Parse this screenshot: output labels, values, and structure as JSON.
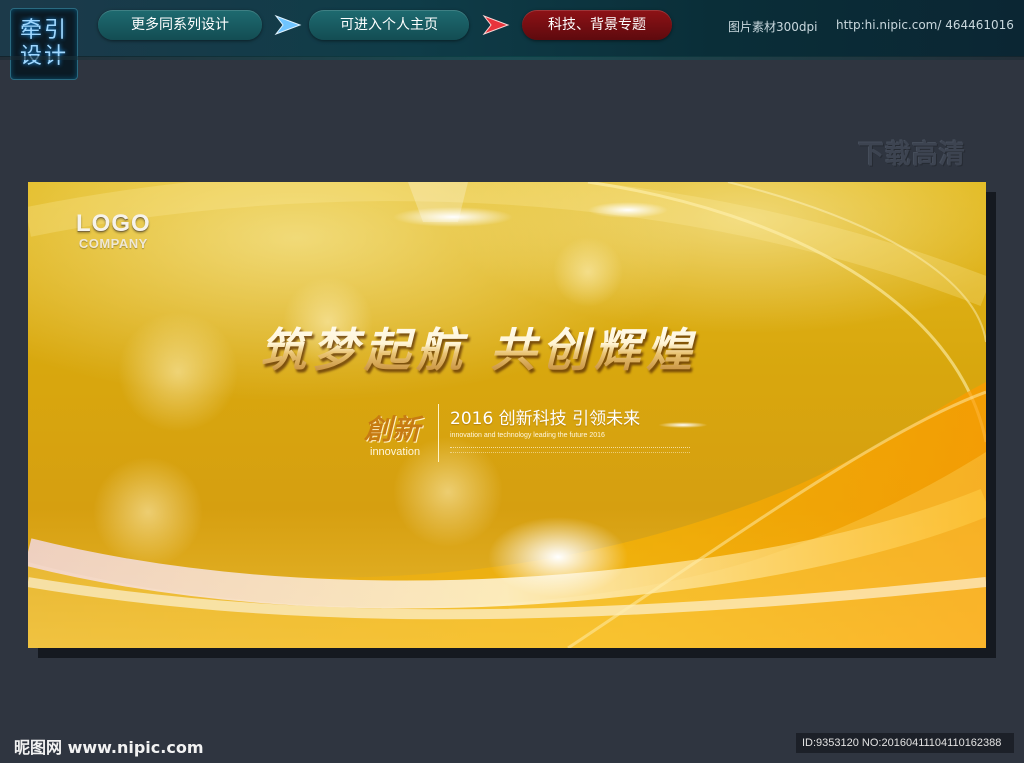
{
  "topbar": {
    "brand_line1": "牵引",
    "brand_line2": "设计",
    "nav": [
      {
        "label": "更多同系列设计"
      },
      {
        "label": "可进入个人主页"
      },
      {
        "label": "科技、背景专题"
      }
    ],
    "resolution_text": "图片素材300dpi",
    "url_text": "http:hi.nipic.com/ 464461016"
  },
  "watermark": "下载高清",
  "banner": {
    "logo_text": "LOGO",
    "company_text": "COMPANY",
    "headline": "筑梦起航 共创辉煌",
    "chuangxin": "創新",
    "innovation": "innovation",
    "subtitle": "2016 创新科技 引领未来",
    "subtitle_en": "innovation and technology leading the future 2016"
  },
  "footer": {
    "brand": "昵图网 www.nipic.com",
    "id_text": "ID:9353120 NO:20160411104110162388"
  },
  "colors": {
    "background": "#2f3540",
    "banner_gold": "#d8a70e",
    "nav_teal": "#1e6b70",
    "nav_red": "#8e1216"
  }
}
